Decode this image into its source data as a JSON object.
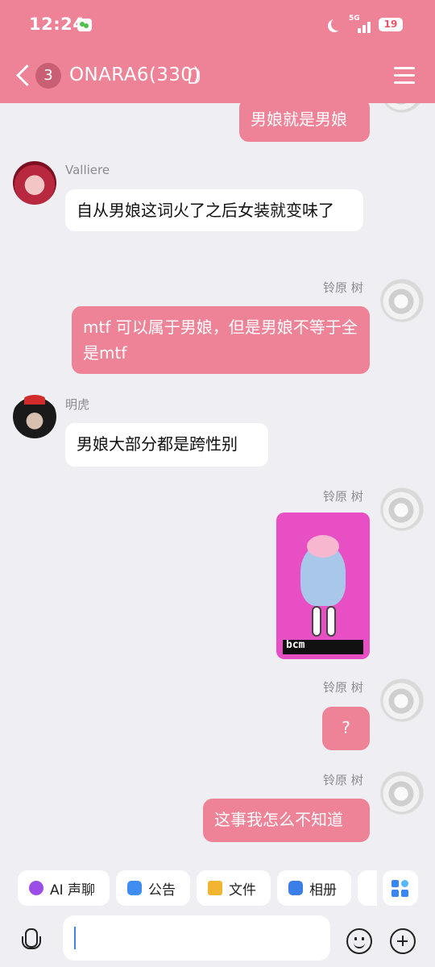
{
  "status_bar": {
    "time": "12:24",
    "network": "5G",
    "battery": "19"
  },
  "header": {
    "unread_count": "3",
    "title": "ONARA6(330)"
  },
  "messages": [
    {
      "side": "right",
      "sender": "",
      "text": "男娘就是男娘"
    },
    {
      "side": "left",
      "sender": "Valliere",
      "text": "自从男娘这词火了之后女装就变味了"
    },
    {
      "side": "right",
      "sender": "铃原 树",
      "text": "mtf 可以属于男娘，但是男娘不等于全是mtf"
    },
    {
      "side": "left",
      "sender": "明虎",
      "text": "男娘大部分都是跨性别"
    },
    {
      "side": "right",
      "sender": "铃原 树",
      "type": "sticker",
      "sticker_text": "bcm"
    },
    {
      "side": "right",
      "sender": "铃原 树",
      "text": "?"
    },
    {
      "side": "right",
      "sender": "铃原 树",
      "text": "这事我怎么不知道"
    }
  ],
  "quick_actions": [
    {
      "label": "AI 声聊",
      "icon": "ai-voice-icon"
    },
    {
      "label": "公告",
      "icon": "announcement-icon"
    },
    {
      "label": "文件",
      "icon": "folder-icon"
    },
    {
      "label": "相册",
      "icon": "album-icon"
    }
  ],
  "input": {
    "placeholder": ""
  },
  "colors": {
    "accent": "#ee8398",
    "background": "#efeef3",
    "bubble_left": "#ffffff"
  }
}
